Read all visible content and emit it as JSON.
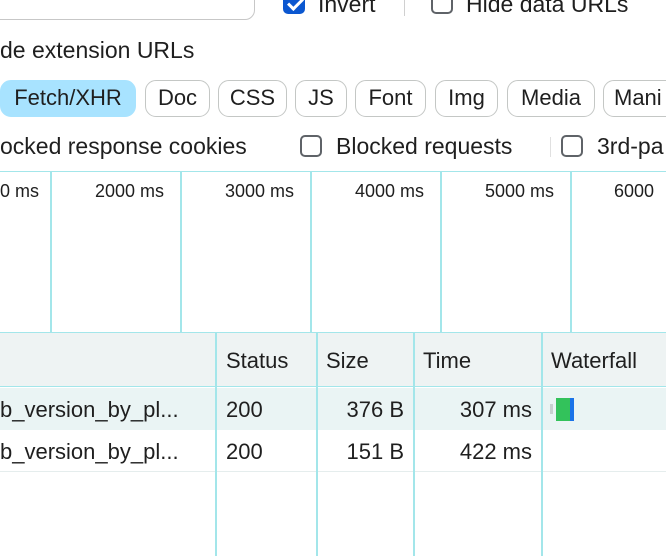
{
  "filters": {
    "invert_label": "Invert",
    "invert_checked": true,
    "hide_data_urls_label": "Hide data URLs",
    "hide_data_urls_checked": false,
    "hide_extension_urls_label": "de extension URLs",
    "type_chips": [
      {
        "label": "Fetch/XHR",
        "active": true
      },
      {
        "label": "Doc",
        "active": false
      },
      {
        "label": "CSS",
        "active": false
      },
      {
        "label": "JS",
        "active": false
      },
      {
        "label": "Font",
        "active": false
      },
      {
        "label": "Img",
        "active": false
      },
      {
        "label": "Media",
        "active": false
      },
      {
        "label": "Mani",
        "active": false
      }
    ],
    "blocked_cookies_label": "ocked response cookies",
    "blocked_requests_label": "Blocked requests",
    "blocked_requests_checked": false,
    "third_party_label": "3rd-pa",
    "third_party_checked": false
  },
  "overview": {
    "ticks": [
      "0 ms",
      "2000 ms",
      "3000 ms",
      "4000 ms",
      "5000 ms",
      "6000"
    ]
  },
  "table": {
    "columns": [
      "Status",
      "Size",
      "Time",
      "Waterfall"
    ],
    "rows": [
      {
        "name": "b_version_by_pl...",
        "status": "200",
        "size": "376 B",
        "time": "307 ms",
        "selected": true
      },
      {
        "name": "b_version_by_pl...",
        "status": "200",
        "size": "151 B",
        "time": "422 ms",
        "selected": false
      }
    ],
    "waterfall_colors": {
      "waiting": "#33c25b",
      "download": "#1a73e8",
      "queue": "#c8d0d0"
    }
  }
}
